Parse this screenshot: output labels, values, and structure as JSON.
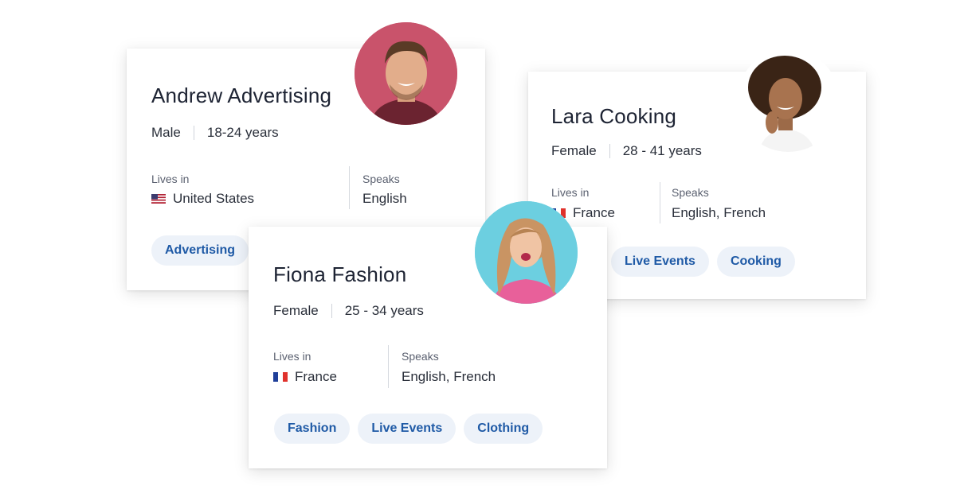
{
  "profiles": [
    {
      "name": "Andrew Advertising",
      "gender": "Male",
      "age": "18-24 years",
      "lives_in_label": "Lives in",
      "country": "United States",
      "country_flag": "us-flag-icon",
      "speaks_label": "Speaks",
      "languages": "English",
      "tags": [
        "Advertising"
      ],
      "avatar_bg": "#c9536b"
    },
    {
      "name": "Lara Cooking",
      "gender": "Female",
      "age": "28 - 41 years",
      "lives_in_label": "Lives in",
      "country": "France",
      "country_flag": "france-flag-icon",
      "speaks_label": "Speaks",
      "languages": "English, French",
      "tags": [
        "Live Events",
        "Cooking"
      ],
      "avatar_bg": "#ffffff"
    },
    {
      "name": "Fiona Fashion",
      "gender": "Female",
      "age": "25 - 34 years",
      "lives_in_label": "Lives in",
      "country": "France",
      "country_flag": "france-flag-icon",
      "speaks_label": "Speaks",
      "languages": "English, French",
      "tags": [
        "Fashion",
        "Live Events",
        "Clothing"
      ],
      "avatar_bg": "#6ccfe0"
    }
  ],
  "colors": {
    "tag_bg": "#edf2f9",
    "tag_text": "#1f5aa6",
    "name_text": "#1d2333"
  }
}
